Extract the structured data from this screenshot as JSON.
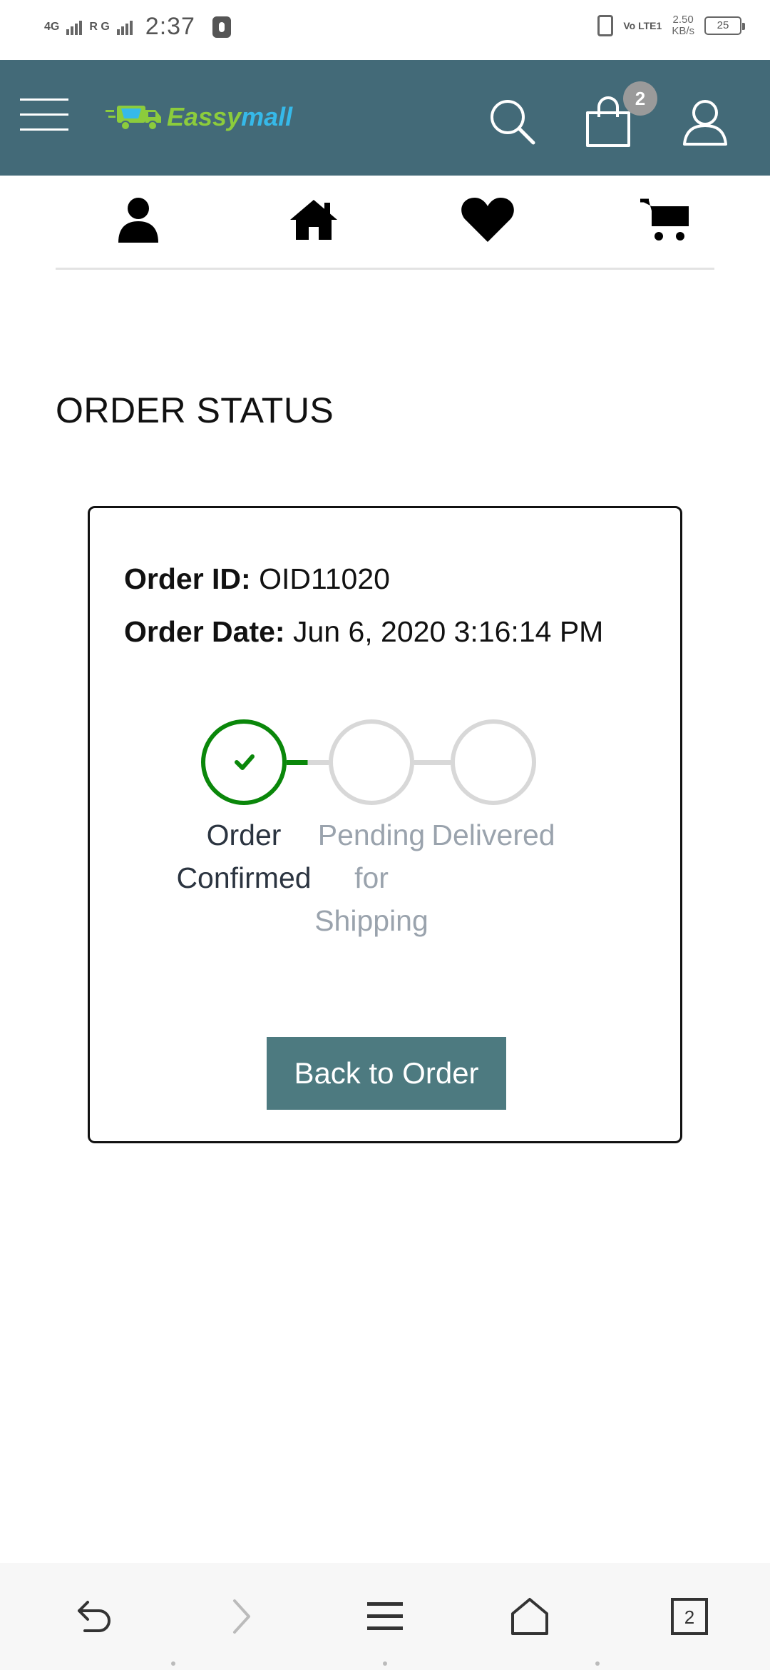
{
  "status_bar": {
    "network_1": "4G",
    "network_2": "R G",
    "time": "2:37",
    "volte": "Vo LTE1",
    "speed_value": "2.50",
    "speed_unit": "KB/s",
    "battery": "25"
  },
  "header": {
    "logo_text_1": "Eassy",
    "logo_text_2": "mall",
    "cart_count": "2",
    "colors": {
      "bar": "#436a78",
      "logo_green": "#8ccc3c",
      "logo_blue": "#36b9e9"
    }
  },
  "quick_nav": {
    "items": [
      "user-icon",
      "home-icon",
      "heart-icon",
      "cart-icon"
    ]
  },
  "page": {
    "title": "ORDER STATUS"
  },
  "order": {
    "id_label": "Order ID:",
    "id_value": " OID11020",
    "date_label": "Order Date:",
    "date_value": " Jun 6, 2020 3:16:14 PM"
  },
  "steps": [
    {
      "label_lines": [
        "Order",
        "Confirmed"
      ],
      "done": true
    },
    {
      "label_lines": [
        "Pending",
        "for",
        "Shipping"
      ],
      "done": false
    },
    {
      "label_lines": [
        "Delivered"
      ],
      "done": false
    }
  ],
  "actions": {
    "back_label": "Back to Order"
  },
  "system_nav": {
    "tabs_count": "2"
  },
  "colors": {
    "step_done": "#0a870a",
    "step_pending": "#d8d8d8",
    "button_bg": "#4d7a80"
  }
}
